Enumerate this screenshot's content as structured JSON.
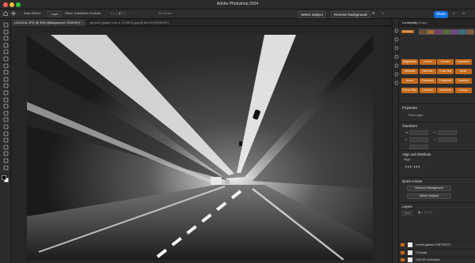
{
  "app": {
    "title": "Adobe Photoshop 2024",
    "colors": {
      "accent": "#1473e6",
      "panel": "#2c2c2c",
      "layer_orange": "#c56a1a"
    }
  },
  "options_bar": {
    "auto_select_label": "Auto-Select:",
    "layer_dropdown": "Layer",
    "show_transform_label": "Show Transform Controls",
    "mode_3d_label": "3D Mode:",
    "select_subject_label": "Select subject",
    "remove_background_label": "Remove background",
    "share_label": "Share"
  },
  "doc_tabs": [
    {
      "label": "L00-6131.JPG @ 33% (Background, RGB/16*) *",
      "active": true
    },
    {
      "label": "generic (guide 4 ss 4- CYBEX4.jpg @ 66.2% (RGB/16*)",
      "active": false
    }
  ],
  "toolbar": {
    "icons": [
      "move-icon",
      "marquee-icon",
      "lasso-icon",
      "object-select-icon",
      "crop-icon",
      "frame-icon",
      "eyedropper-icon",
      "healing-icon",
      "brush-icon",
      "clone-stamp-icon",
      "history-brush-icon",
      "eraser-icon",
      "gradient-icon",
      "blur-icon",
      "dodge-icon",
      "pen-icon",
      "type-icon",
      "path-select-icon",
      "shape-icon",
      "hand-icon",
      "zoom-icon",
      "more-tools-icon"
    ]
  },
  "right_strip": {
    "icons": [
      "adjustments-icon",
      "properties-icon",
      "layers-icon",
      "history-icon",
      "brushes-icon",
      "color-icon",
      "swatches-icon"
    ]
  },
  "panel_tabs": {
    "first": "Luminosity",
    "second": "Masks"
  },
  "adjustments": {
    "presets_label": "Presets",
    "preset_colors": [
      "#6b4d2f",
      "#a66b2c",
      "#7a3a6e",
      "#5a6e3a",
      "#6e4a8a",
      "#3a6e8a",
      "#8a5a3a"
    ],
    "buttons_row1": [
      {
        "label": "Brightness",
        "color": "#c56a1a"
      },
      {
        "label": "Levels",
        "color": "#c56a1a"
      },
      {
        "label": "Curves",
        "color": "#c56a1a"
      },
      {
        "label": "Exposure",
        "color": "#c56a1a"
      }
    ],
    "buttons_row2": [
      {
        "label": "Vibrance",
        "color": "#c56a1a"
      },
      {
        "label": "Hue/Sat",
        "color": "#c56a1a"
      },
      {
        "label": "Color Bal",
        "color": "#c56a1a"
      },
      {
        "label": "B&W",
        "color": "#c56a1a"
      }
    ],
    "buttons_row3": [
      {
        "label": "Invert",
        "color": "#c56a1a"
      },
      {
        "label": "Posterize",
        "color": "#c56a1a"
      },
      {
        "label": "Threshold",
        "color": "#c56a1a"
      },
      {
        "label": "Gradient",
        "color": "#c56a1a"
      }
    ],
    "buttons_row4": [
      {
        "label": "Photo Filter",
        "color": "#c56a1a"
      },
      {
        "label": "Channel",
        "color": "#c56a1a"
      },
      {
        "label": "Selective",
        "color": "#c56a1a"
      },
      {
        "label": "Lookup",
        "color": "#c56a1a"
      }
    ]
  },
  "properties": {
    "title": "Properties",
    "pixel_layer_label": "Pixel Layer",
    "transform_title": "Transform",
    "transform_fields": [
      "W",
      "H",
      "X",
      "Y"
    ],
    "align_title": "Align and Distribute",
    "align_sub": "Align",
    "quick_actions_title": "Quick Actions",
    "remove_bg_label": "Remove Background",
    "select_subject_label": "Select Subject",
    "show_more_label": "Show More"
  },
  "layers": {
    "title": "Layers",
    "kind_label": "Kind",
    "items": [
      {
        "name": "Levels (global CONTRAST)",
        "color": "#c56a1a"
      },
      {
        "name": "HI (local)",
        "color": "#c56a1a"
      },
      {
        "name": "COLOR correction)",
        "color": "#c56a1a"
      },
      {
        "name": "Background",
        "color": "#c56a1a"
      }
    ]
  }
}
